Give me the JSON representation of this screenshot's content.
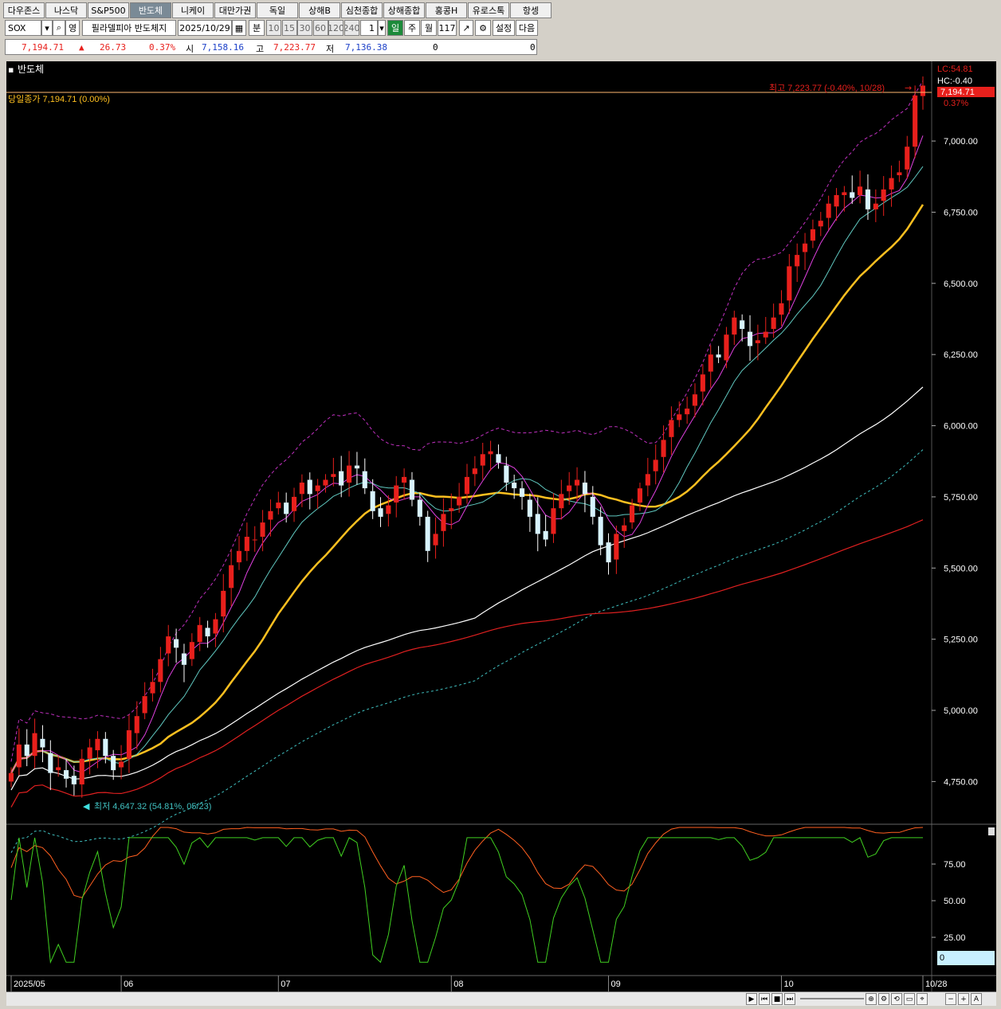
{
  "tabs": [
    {
      "label": "다우존스"
    },
    {
      "label": "나스닥"
    },
    {
      "label": "S&P500"
    },
    {
      "label": "반도체",
      "active": true
    },
    {
      "label": "니케이"
    },
    {
      "label": "대만가권"
    },
    {
      "label": "독일"
    },
    {
      "label": "상해B"
    },
    {
      "label": "심천종합"
    },
    {
      "label": "상해종합"
    },
    {
      "label": "홍콩H"
    },
    {
      "label": "유로스톡"
    },
    {
      "label": "항셍"
    }
  ],
  "toolbar": {
    "symbol": "SOX",
    "search_icon": "search-icon",
    "lang": "영",
    "name": "필라델피아 반도체지",
    "date": "2025/10/29",
    "unit": "분",
    "intervals": [
      "10",
      "15",
      "30",
      "60",
      "120",
      "240"
    ],
    "count": "1",
    "day": "일",
    "week": "주",
    "month": "월",
    "bars": "117",
    "settings": "설정",
    "next": "다음"
  },
  "quote": {
    "close": "7,194.71",
    "arrow": "▲",
    "change": "26.73",
    "pct": "0.37%",
    "open_lbl": "시",
    "open": "7,158.16",
    "high_lbl": "고",
    "high": "7,223.77",
    "low_lbl": "저",
    "low": "7,136.38",
    "vol1": "0",
    "vol2": "0"
  },
  "colors": {
    "up": "#e8201c",
    "down": "#1c40c8",
    "panel": "#000000",
    "ma5": "#e040e0",
    "ma10": "#60c8c0",
    "ma20": "#ffc020",
    "ma60": "#ffffff",
    "ma120": "#e02020",
    "bband": "#c030c0",
    "lowband": "#40c0c0",
    "stochK": "#40d020",
    "stochD": "#ff6020"
  },
  "chart": {
    "title": "반도체",
    "close_label": "당일종가 7,194.71 (0.00%)",
    "high_note": "최고 7,223.77 (-0.40%, 10/28)",
    "low_note": "최저 4,647.32 (54.81%, 05/23)",
    "lc": "LC:54.81",
    "hc": "HC:-0.40",
    "last_price": "7,194.71",
    "last_pct": "0.37%",
    "y_ticks": [
      "7,000.00",
      "6,750.00",
      "6,500.00",
      "6,250.00",
      "6,000.00",
      "5,750.00",
      "5,500.00",
      "5,250.00",
      "5,000.00",
      "4,750.00"
    ],
    "y_values": [
      7000,
      6750,
      6500,
      6250,
      6000,
      5750,
      5500,
      5250,
      5000,
      4750
    ],
    "ind_ticks": [
      "75.00",
      "50.00",
      "25.00"
    ],
    "ind_values": [
      75,
      50,
      25
    ],
    "ind_last": "0",
    "ind_last_pct": "0.00%",
    "x_labels": [
      {
        "label": "2025/05",
        "idx": 0
      },
      {
        "label": "06",
        "idx": 14
      },
      {
        "label": "07",
        "idx": 34
      },
      {
        "label": "08",
        "idx": 56
      },
      {
        "label": "09",
        "idx": 76
      },
      {
        "label": "10",
        "idx": 98
      },
      {
        "label": "10/28",
        "idx": 116
      }
    ]
  },
  "chart_data": {
    "type": "candlestick",
    "ylim": [
      4600,
      7280
    ],
    "indicator_ylim": [
      0,
      100
    ],
    "closes": [
      4780,
      4880,
      4840,
      4920,
      4870,
      4780,
      4800,
      4760,
      4740,
      4830,
      4870,
      4900,
      4840,
      4790,
      4820,
      4930,
      4980,
      5050,
      5100,
      5180,
      5260,
      5220,
      5160,
      5240,
      5300,
      5260,
      5320,
      5420,
      5510,
      5560,
      5610,
      5600,
      5660,
      5700,
      5730,
      5690,
      5750,
      5800,
      5760,
      5790,
      5810,
      5830,
      5790,
      5860,
      5850,
      5780,
      5700,
      5680,
      5720,
      5790,
      5820,
      5740,
      5680,
      5560,
      5620,
      5690,
      5710,
      5750,
      5820,
      5850,
      5900,
      5910,
      5870,
      5800,
      5780,
      5750,
      5680,
      5620,
      5600,
      5710,
      5760,
      5790,
      5810,
      5760,
      5680,
      5580,
      5520,
      5620,
      5650,
      5720,
      5780,
      5830,
      5880,
      5950,
      6020,
      6040,
      6060,
      6110,
      6180,
      6250,
      6240,
      6320,
      6380,
      6340,
      6280,
      6300,
      6330,
      6380,
      6430,
      6560,
      6600,
      6640,
      6690,
      6720,
      6780,
      6810,
      6820,
      6800,
      6840,
      6760,
      6780,
      6830,
      6870,
      6890,
      6980,
      7160,
      7194.71
    ],
    "opens": [
      4750,
      4800,
      4880,
      4840,
      4900,
      4850,
      4790,
      4790,
      4770,
      4740,
      4830,
      4860,
      4900,
      4840,
      4800,
      4830,
      4920,
      4990,
      5060,
      5100,
      5200,
      5250,
      5200,
      5180,
      5240,
      5290,
      5270,
      5330,
      5430,
      5520,
      5560,
      5600,
      5610,
      5670,
      5710,
      5730,
      5700,
      5760,
      5810,
      5770,
      5790,
      5820,
      5840,
      5800,
      5860,
      5840,
      5770,
      5710,
      5690,
      5730,
      5800,
      5810,
      5740,
      5680,
      5580,
      5630,
      5700,
      5720,
      5760,
      5830,
      5860,
      5900,
      5900,
      5860,
      5800,
      5780,
      5740,
      5690,
      5630,
      5620,
      5710,
      5770,
      5790,
      5800,
      5750,
      5680,
      5590,
      5530,
      5630,
      5660,
      5730,
      5790,
      5840,
      5890,
      5960,
      6020,
      6040,
      6070,
      6120,
      6190,
      6250,
      6230,
      6320,
      6370,
      6330,
      6290,
      6310,
      6340,
      6390,
      6440,
      6560,
      6610,
      6650,
      6700,
      6730,
      6770,
      6810,
      6820,
      6810,
      6830,
      6760,
      6790,
      6830,
      6880,
      6900,
      6980,
      7158.16
    ],
    "series": [
      {
        "name": "MA5"
      },
      {
        "name": "MA10"
      },
      {
        "name": "MA20"
      },
      {
        "name": "MA60"
      },
      {
        "name": "MA120"
      }
    ]
  }
}
